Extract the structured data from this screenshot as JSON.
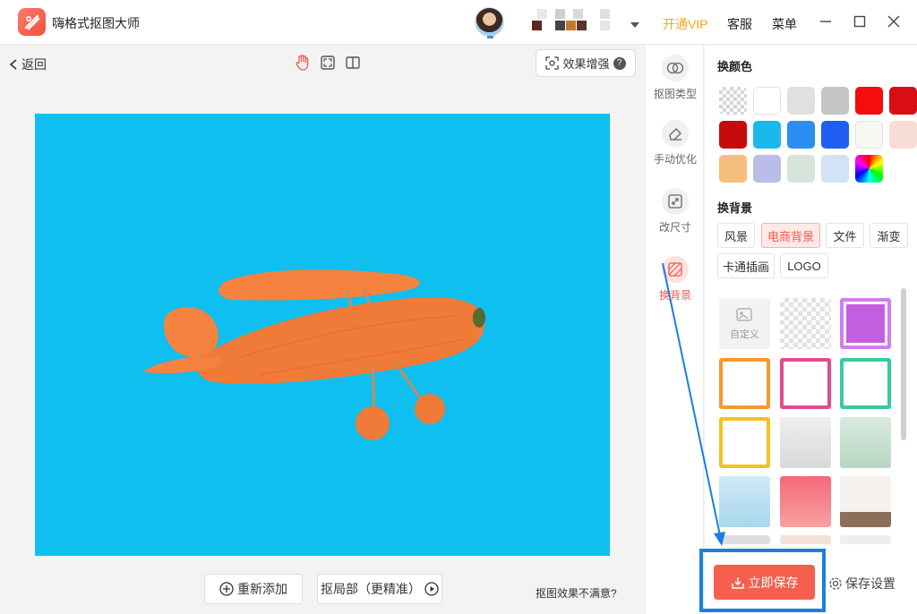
{
  "app": {
    "title": "嗨格式抠图大师"
  },
  "header": {
    "vip": "开通VIP",
    "service": "客服",
    "menu": "菜单"
  },
  "toolbar": {
    "back": "返回",
    "enhance": "效果增强",
    "help_mark": "?"
  },
  "actions": {
    "readd": "重新添加",
    "local_refine": "抠局部（更精准）",
    "unsatisfied": "抠图效果不满意?"
  },
  "sidenav": [
    {
      "label": "抠图类型",
      "icon": "cutout-type-icon"
    },
    {
      "label": "手动优化",
      "icon": "eraser-icon"
    },
    {
      "label": "改尺寸",
      "icon": "resize-icon"
    },
    {
      "label": "换背景",
      "icon": "background-icon"
    }
  ],
  "panel": {
    "color_title": "换颜色",
    "colors": [
      "transparent",
      "#ffffff",
      "#e0e0e0",
      "#c6c4c4",
      "#f50c0c",
      "#d90d14",
      "#c70a0a",
      "#1ab9ec",
      "#2b8df0",
      "#1f5ef0",
      "#f7f7f3",
      "#f7ddd6",
      "#f5c07d",
      "#b9bde8",
      "#d7e3db",
      "#d1e3f5",
      "rainbow"
    ],
    "bg_title": "换背景",
    "tabs": [
      "风景",
      "电商背景",
      "文件",
      "渐变",
      "卡通插画",
      "LOGO"
    ],
    "active_tab": "电商背景",
    "custom_label": "自定义"
  },
  "footer": {
    "save": "立即保存",
    "save_settings": "保存设置"
  }
}
